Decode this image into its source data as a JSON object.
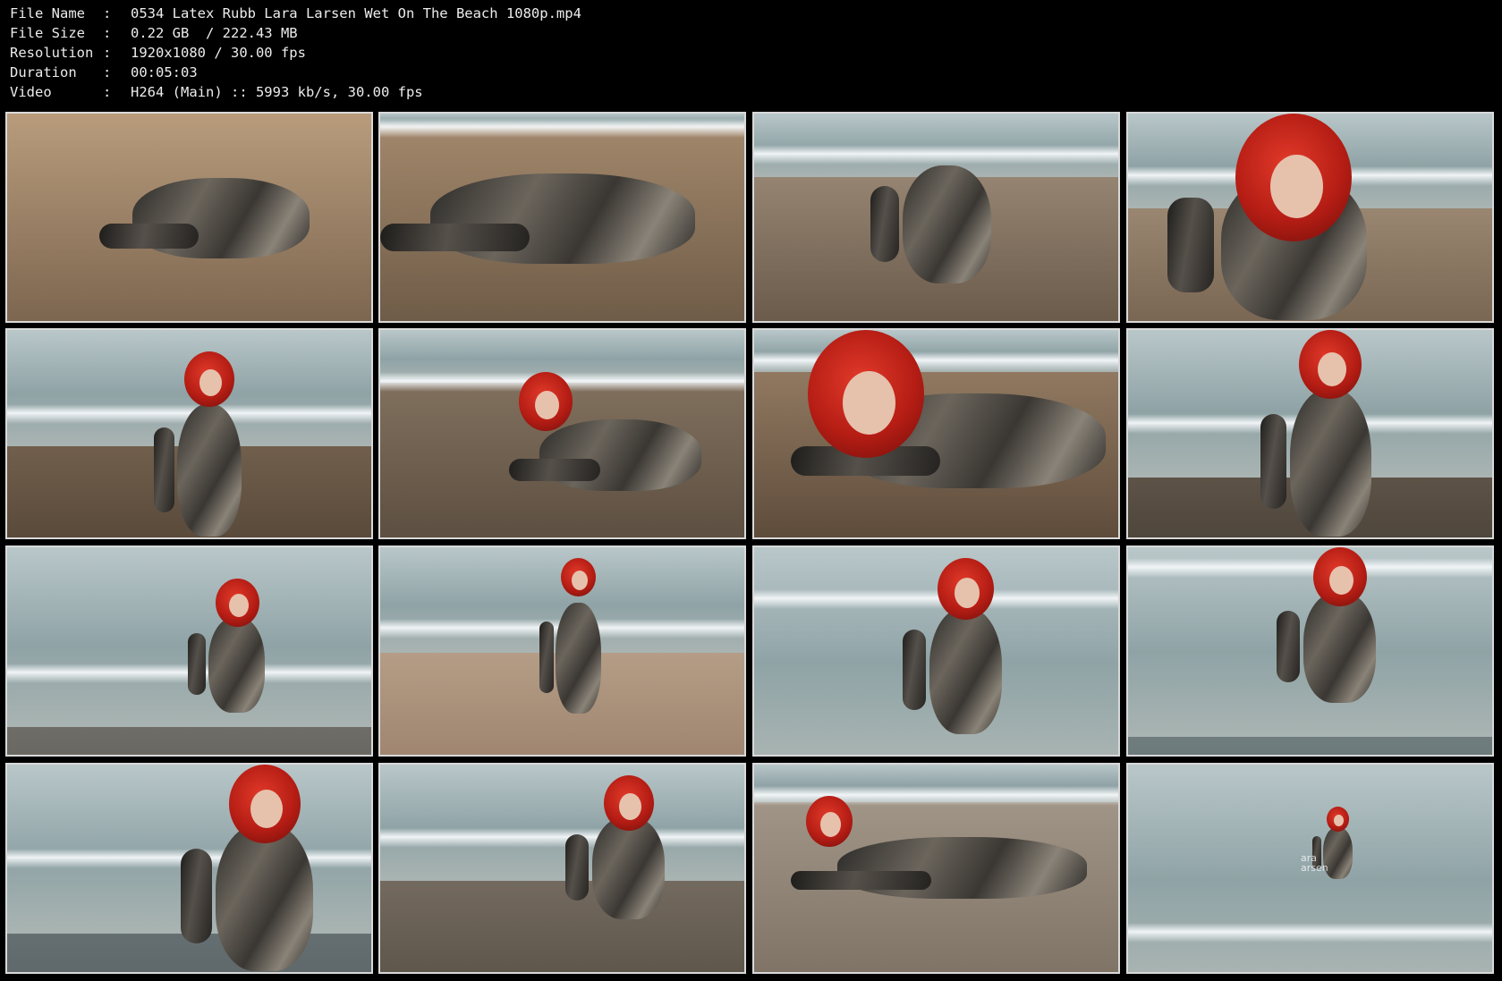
{
  "file_info": [
    {
      "label": "File Name",
      "sep": ":",
      "value": "0534 Latex Rubb Lara Larsen Wet On The Beach 1080p.mp4"
    },
    {
      "label": "File Size",
      "sep": ":",
      "value": "0.22 GB  / 222.43 MB"
    },
    {
      "label": "Resolution",
      "sep": ":",
      "value": "1920x1080 / 30.00 fps"
    },
    {
      "label": "Duration",
      "sep": ":",
      "value": "00:05:03"
    },
    {
      "label": "Video",
      "sep": ":",
      "value": "H264 (Main) :: 5993 kb/s, 30.00 fps"
    }
  ],
  "grid": {
    "columns": 4,
    "rows": 4,
    "frames": [
      {
        "scene": "sand-closeup-legs"
      },
      {
        "scene": "sand-closeup-arm"
      },
      {
        "scene": "shoreline-sitting"
      },
      {
        "scene": "shoreline-redhead-sitting"
      },
      {
        "scene": "surf-sitting-smile"
      },
      {
        "scene": "surf-lying"
      },
      {
        "scene": "sand-lying-closeup"
      },
      {
        "scene": "surf-kneeling"
      },
      {
        "scene": "water-sitting"
      },
      {
        "scene": "shore-kneeling-sunset"
      },
      {
        "scene": "wave-splash"
      },
      {
        "scene": "water-kneeling-arms"
      },
      {
        "scene": "wave-closeup"
      },
      {
        "scene": "surf-crawling"
      },
      {
        "scene": "shore-lying"
      },
      {
        "scene": "water-distant",
        "watermark": "ara\narsen"
      }
    ]
  },
  "colors": {
    "background": "#000000",
    "header_text": "#ececec",
    "thumb_border": "#d9d9d9",
    "sand": "#a08a72",
    "sea": "#9fb0b3",
    "hair": "#c1231a",
    "latex": "#4a4640"
  }
}
